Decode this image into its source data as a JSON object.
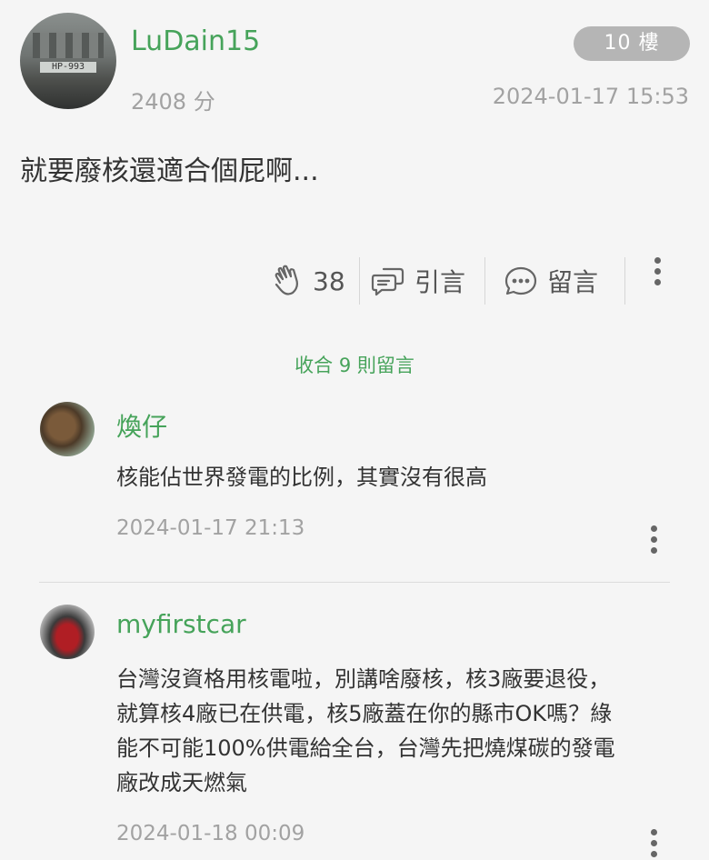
{
  "post": {
    "username": "LuDain15",
    "avatar_plate_text": "HP-993",
    "floor": "10 樓",
    "score": "2408 分",
    "timestamp": "2024-01-17 15:53",
    "content": "就要廢核還適合個屁啊...",
    "actions": {
      "like_count": "38",
      "quote_label": "引言",
      "comment_label": "留言"
    }
  },
  "collapse_label": "收合 9 則留言",
  "comments": [
    {
      "username": "煥仔",
      "text": "核能佔世界發電的比例，其實沒有很高",
      "timestamp": "2024-01-17 21:13"
    },
    {
      "username": "myfirstcar",
      "text_lines": [
        "台灣沒資格用核電啦，別講啥廢核，核3廠要退役，",
        "就算核4廠已在供電，核5廠蓋在你的縣市OK嗎？綠",
        "能不可能100%供電給全台，台灣先把燒煤碳的發電",
        "廠改成天燃氣"
      ],
      "timestamp": "2024-01-18 00:09"
    }
  ],
  "colors": {
    "accent_green": "#46a35a",
    "background": "#f5f5f5",
    "badge_gray": "#b5b5b5",
    "meta_gray": "#a2a2a2"
  }
}
